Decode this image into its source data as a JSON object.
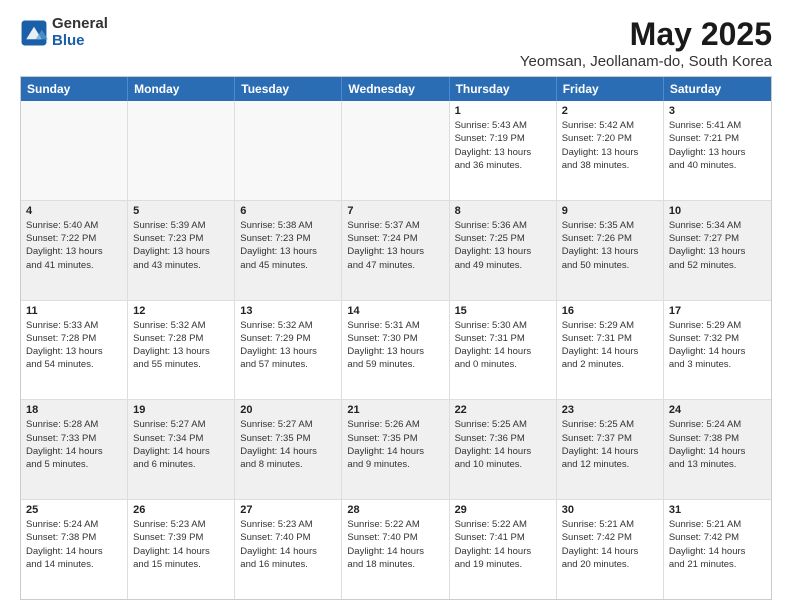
{
  "logo": {
    "general": "General",
    "blue": "Blue"
  },
  "title": "May 2025",
  "subtitle": "Yeomsan, Jeollanam-do, South Korea",
  "header_days": [
    "Sunday",
    "Monday",
    "Tuesday",
    "Wednesday",
    "Thursday",
    "Friday",
    "Saturday"
  ],
  "weeks": [
    [
      {
        "day": "",
        "info": [],
        "empty": true
      },
      {
        "day": "",
        "info": [],
        "empty": true
      },
      {
        "day": "",
        "info": [],
        "empty": true
      },
      {
        "day": "",
        "info": [],
        "empty": true
      },
      {
        "day": "1",
        "info": [
          "Sunrise: 5:43 AM",
          "Sunset: 7:19 PM",
          "Daylight: 13 hours",
          "and 36 minutes."
        ],
        "empty": false
      },
      {
        "day": "2",
        "info": [
          "Sunrise: 5:42 AM",
          "Sunset: 7:20 PM",
          "Daylight: 13 hours",
          "and 38 minutes."
        ],
        "empty": false
      },
      {
        "day": "3",
        "info": [
          "Sunrise: 5:41 AM",
          "Sunset: 7:21 PM",
          "Daylight: 13 hours",
          "and 40 minutes."
        ],
        "empty": false
      }
    ],
    [
      {
        "day": "4",
        "info": [
          "Sunrise: 5:40 AM",
          "Sunset: 7:22 PM",
          "Daylight: 13 hours",
          "and 41 minutes."
        ],
        "empty": false
      },
      {
        "day": "5",
        "info": [
          "Sunrise: 5:39 AM",
          "Sunset: 7:23 PM",
          "Daylight: 13 hours",
          "and 43 minutes."
        ],
        "empty": false
      },
      {
        "day": "6",
        "info": [
          "Sunrise: 5:38 AM",
          "Sunset: 7:23 PM",
          "Daylight: 13 hours",
          "and 45 minutes."
        ],
        "empty": false
      },
      {
        "day": "7",
        "info": [
          "Sunrise: 5:37 AM",
          "Sunset: 7:24 PM",
          "Daylight: 13 hours",
          "and 47 minutes."
        ],
        "empty": false
      },
      {
        "day": "8",
        "info": [
          "Sunrise: 5:36 AM",
          "Sunset: 7:25 PM",
          "Daylight: 13 hours",
          "and 49 minutes."
        ],
        "empty": false
      },
      {
        "day": "9",
        "info": [
          "Sunrise: 5:35 AM",
          "Sunset: 7:26 PM",
          "Daylight: 13 hours",
          "and 50 minutes."
        ],
        "empty": false
      },
      {
        "day": "10",
        "info": [
          "Sunrise: 5:34 AM",
          "Sunset: 7:27 PM",
          "Daylight: 13 hours",
          "and 52 minutes."
        ],
        "empty": false
      }
    ],
    [
      {
        "day": "11",
        "info": [
          "Sunrise: 5:33 AM",
          "Sunset: 7:28 PM",
          "Daylight: 13 hours",
          "and 54 minutes."
        ],
        "empty": false
      },
      {
        "day": "12",
        "info": [
          "Sunrise: 5:32 AM",
          "Sunset: 7:28 PM",
          "Daylight: 13 hours",
          "and 55 minutes."
        ],
        "empty": false
      },
      {
        "day": "13",
        "info": [
          "Sunrise: 5:32 AM",
          "Sunset: 7:29 PM",
          "Daylight: 13 hours",
          "and 57 minutes."
        ],
        "empty": false
      },
      {
        "day": "14",
        "info": [
          "Sunrise: 5:31 AM",
          "Sunset: 7:30 PM",
          "Daylight: 13 hours",
          "and 59 minutes."
        ],
        "empty": false
      },
      {
        "day": "15",
        "info": [
          "Sunrise: 5:30 AM",
          "Sunset: 7:31 PM",
          "Daylight: 14 hours",
          "and 0 minutes."
        ],
        "empty": false
      },
      {
        "day": "16",
        "info": [
          "Sunrise: 5:29 AM",
          "Sunset: 7:31 PM",
          "Daylight: 14 hours",
          "and 2 minutes."
        ],
        "empty": false
      },
      {
        "day": "17",
        "info": [
          "Sunrise: 5:29 AM",
          "Sunset: 7:32 PM",
          "Daylight: 14 hours",
          "and 3 minutes."
        ],
        "empty": false
      }
    ],
    [
      {
        "day": "18",
        "info": [
          "Sunrise: 5:28 AM",
          "Sunset: 7:33 PM",
          "Daylight: 14 hours",
          "and 5 minutes."
        ],
        "empty": false
      },
      {
        "day": "19",
        "info": [
          "Sunrise: 5:27 AM",
          "Sunset: 7:34 PM",
          "Daylight: 14 hours",
          "and 6 minutes."
        ],
        "empty": false
      },
      {
        "day": "20",
        "info": [
          "Sunrise: 5:27 AM",
          "Sunset: 7:35 PM",
          "Daylight: 14 hours",
          "and 8 minutes."
        ],
        "empty": false
      },
      {
        "day": "21",
        "info": [
          "Sunrise: 5:26 AM",
          "Sunset: 7:35 PM",
          "Daylight: 14 hours",
          "and 9 minutes."
        ],
        "empty": false
      },
      {
        "day": "22",
        "info": [
          "Sunrise: 5:25 AM",
          "Sunset: 7:36 PM",
          "Daylight: 14 hours",
          "and 10 minutes."
        ],
        "empty": false
      },
      {
        "day": "23",
        "info": [
          "Sunrise: 5:25 AM",
          "Sunset: 7:37 PM",
          "Daylight: 14 hours",
          "and 12 minutes."
        ],
        "empty": false
      },
      {
        "day": "24",
        "info": [
          "Sunrise: 5:24 AM",
          "Sunset: 7:38 PM",
          "Daylight: 14 hours",
          "and 13 minutes."
        ],
        "empty": false
      }
    ],
    [
      {
        "day": "25",
        "info": [
          "Sunrise: 5:24 AM",
          "Sunset: 7:38 PM",
          "Daylight: 14 hours",
          "and 14 minutes."
        ],
        "empty": false
      },
      {
        "day": "26",
        "info": [
          "Sunrise: 5:23 AM",
          "Sunset: 7:39 PM",
          "Daylight: 14 hours",
          "and 15 minutes."
        ],
        "empty": false
      },
      {
        "day": "27",
        "info": [
          "Sunrise: 5:23 AM",
          "Sunset: 7:40 PM",
          "Daylight: 14 hours",
          "and 16 minutes."
        ],
        "empty": false
      },
      {
        "day": "28",
        "info": [
          "Sunrise: 5:22 AM",
          "Sunset: 7:40 PM",
          "Daylight: 14 hours",
          "and 18 minutes."
        ],
        "empty": false
      },
      {
        "day": "29",
        "info": [
          "Sunrise: 5:22 AM",
          "Sunset: 7:41 PM",
          "Daylight: 14 hours",
          "and 19 minutes."
        ],
        "empty": false
      },
      {
        "day": "30",
        "info": [
          "Sunrise: 5:21 AM",
          "Sunset: 7:42 PM",
          "Daylight: 14 hours",
          "and 20 minutes."
        ],
        "empty": false
      },
      {
        "day": "31",
        "info": [
          "Sunrise: 5:21 AM",
          "Sunset: 7:42 PM",
          "Daylight: 14 hours",
          "and 21 minutes."
        ],
        "empty": false
      }
    ]
  ]
}
